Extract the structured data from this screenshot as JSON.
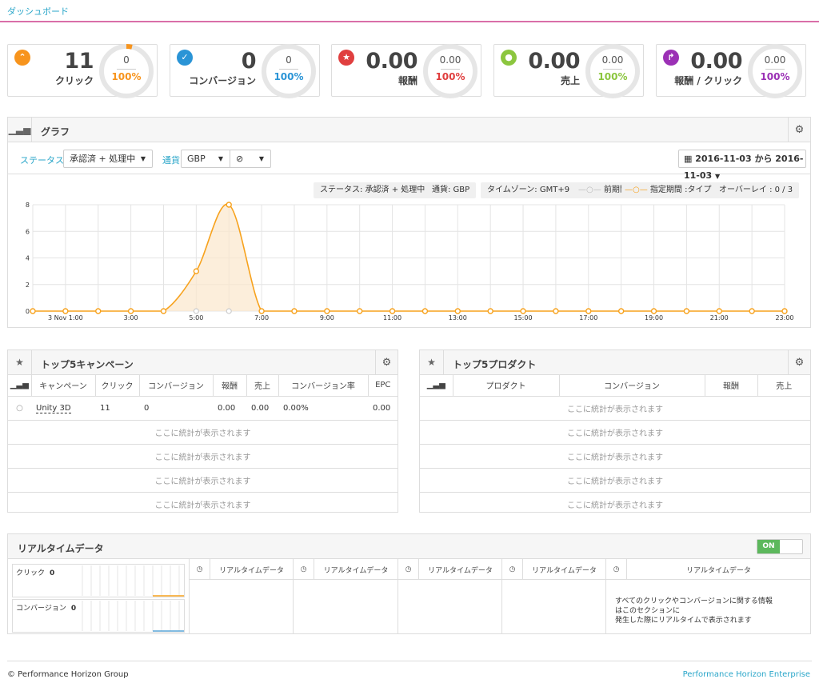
{
  "header": {
    "title": "ダッシュボード"
  },
  "kpis": [
    {
      "value": "11",
      "label": "クリック",
      "donut_value": "0",
      "percent": "100%",
      "color": "#f7941d",
      "icon": "chevron-up-icon",
      "icon_glyph": "⌃"
    },
    {
      "value": "0",
      "label": "コンバージョン",
      "donut_value": "0",
      "percent": "100%",
      "color": "#2a94d6",
      "icon": "check-icon",
      "icon_glyph": "✓"
    },
    {
      "value": "0.00",
      "label": "報酬",
      "donut_value": "0.00",
      "percent": "100%",
      "color": "#e03f3f",
      "icon": "star-icon",
      "icon_glyph": "★"
    },
    {
      "value": "0.00",
      "label": "売上",
      "donut_value": "0.00",
      "percent": "100%",
      "color": "#8cc63f",
      "icon": "tag-icon",
      "icon_glyph": "●"
    },
    {
      "value": "0.00",
      "label": "報酬 / クリック",
      "donut_value": "0.00",
      "percent": "100%",
      "color": "#9b30b5",
      "icon": "share-icon",
      "icon_glyph": "↱"
    }
  ],
  "graph": {
    "title": "グラフ",
    "status_label": "ステータス",
    "status_value": "承認済 + 処理中",
    "currency_label": "通貨",
    "currency_value": "GBP",
    "extra_value": "⊘",
    "date_range": "2016-11-03 から 2016-11-03",
    "badges": {
      "status": "ステータス: 承認済 + 処理中",
      "currency": "通貨: GBP",
      "timezone": "タイムゾーン: GMT+9",
      "previous": "前期間",
      "current": "指定期間 :タイプ",
      "overlay": "オーバーレイ : 0 / 3"
    }
  },
  "chart_data": {
    "type": "line",
    "x": [
      "0:00",
      "1:00",
      "2:00",
      "3:00",
      "4:00",
      "5:00",
      "6:00",
      "7:00",
      "8:00",
      "9:00",
      "10:00",
      "11:00",
      "12:00",
      "13:00",
      "14:00",
      "15:00",
      "16:00",
      "17:00",
      "18:00",
      "19:00",
      "20:00",
      "21:00",
      "22:00",
      "23:00"
    ],
    "tick_labels": [
      "3 Nov 1:00",
      "3:00",
      "5:00",
      "7:00",
      "9:00",
      "11:00",
      "13:00",
      "15:00",
      "17:00",
      "19:00",
      "21:00",
      "23:00"
    ],
    "series": [
      {
        "name": "指定期間 :タイプ",
        "color": "#f7a21d",
        "values": [
          0,
          0,
          0,
          0,
          0,
          3,
          8,
          0,
          0,
          0,
          0,
          0,
          0,
          0,
          0,
          0,
          0,
          0,
          0,
          0,
          0,
          0,
          0,
          0
        ]
      },
      {
        "name": "前期間",
        "color": "#cccccc",
        "values": [
          null,
          null,
          null,
          null,
          null,
          0,
          0,
          null,
          null,
          null,
          null,
          null,
          null,
          null,
          null,
          null,
          null,
          null,
          null,
          null,
          null,
          null,
          null,
          null
        ]
      }
    ],
    "ylim": [
      0,
      8
    ],
    "yticks": [
      0,
      2,
      4,
      6,
      8
    ],
    "grid": true
  },
  "campaigns": {
    "title": "トップ5キャンペーン",
    "columns": [
      "キャンペーン",
      "クリック",
      "コンバージョン",
      "報酬",
      "売上",
      "コンバージョン率",
      "EPC"
    ],
    "row": {
      "name": "Unity 3D",
      "clicks": "11",
      "conversions": "0",
      "reward": "0.00",
      "sales": "0.00",
      "rate": "0.00%",
      "epc": "0.00"
    },
    "empty_text": "ここに統計が表示されます"
  },
  "products": {
    "title": "トップ5プロダクト",
    "columns": [
      "プロダクト",
      "コンバージョン",
      "報酬",
      "売上"
    ],
    "empty_text": "ここに統計が表示されます"
  },
  "realtime": {
    "title": "リアルタイムデータ",
    "toggle": "ON",
    "clicks_label": "クリック",
    "clicks_value": "0",
    "conversions_label": "コンバージョン",
    "conversions_value": "0",
    "column_label": "リアルタイムデータ",
    "info_line1": "すべてのクリックやコンバージョンに関する情報",
    "info_line2": "はこのセクションに",
    "info_line3": "発生した際にリアルタイムで表示されます"
  },
  "footer": {
    "left": "© Performance Horizon Group",
    "right": "Performance Horizon Enterprise"
  }
}
